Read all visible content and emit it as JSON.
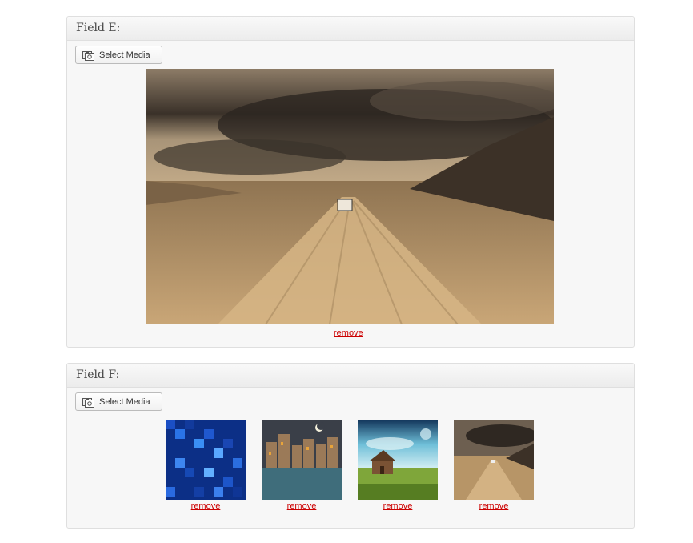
{
  "field_e": {
    "title": "Field E:",
    "button_label": "Select Media",
    "remove_label": "remove",
    "image": "desert-road-storm-image"
  },
  "field_f": {
    "title": "Field F:",
    "button_label": "Select Media",
    "items": [
      {
        "image": "blue-mosaic-image",
        "remove_label": "remove"
      },
      {
        "image": "night-city-image",
        "remove_label": "remove"
      },
      {
        "image": "house-meadow-image",
        "remove_label": "remove"
      },
      {
        "image": "desert-road-thumb-image",
        "remove_label": "remove"
      }
    ]
  },
  "colors": {
    "link": "#cc0000",
    "panel_bg": "#f7f7f7",
    "border": "#dfdfdf"
  }
}
